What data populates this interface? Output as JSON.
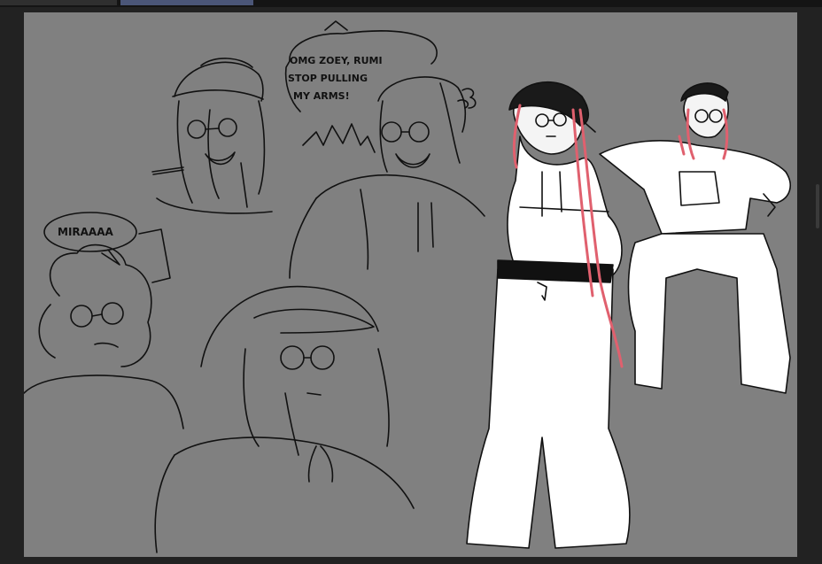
{
  "app": {
    "tabs": [
      {
        "label": "",
        "active": false
      },
      {
        "label": "",
        "active": true
      }
    ],
    "colors": {
      "tab_active": "#4b5678",
      "canvas_bg": "#808080",
      "workspace_bg": "#222222",
      "hair_accent": "#e0606e"
    }
  },
  "canvas": {
    "speech_bubble_top": [
      "OMG ZOEY, RUMI",
      "STOP PULLING",
      "MY ARMS!"
    ],
    "speech_bubble_left": "MIRAAAA"
  }
}
